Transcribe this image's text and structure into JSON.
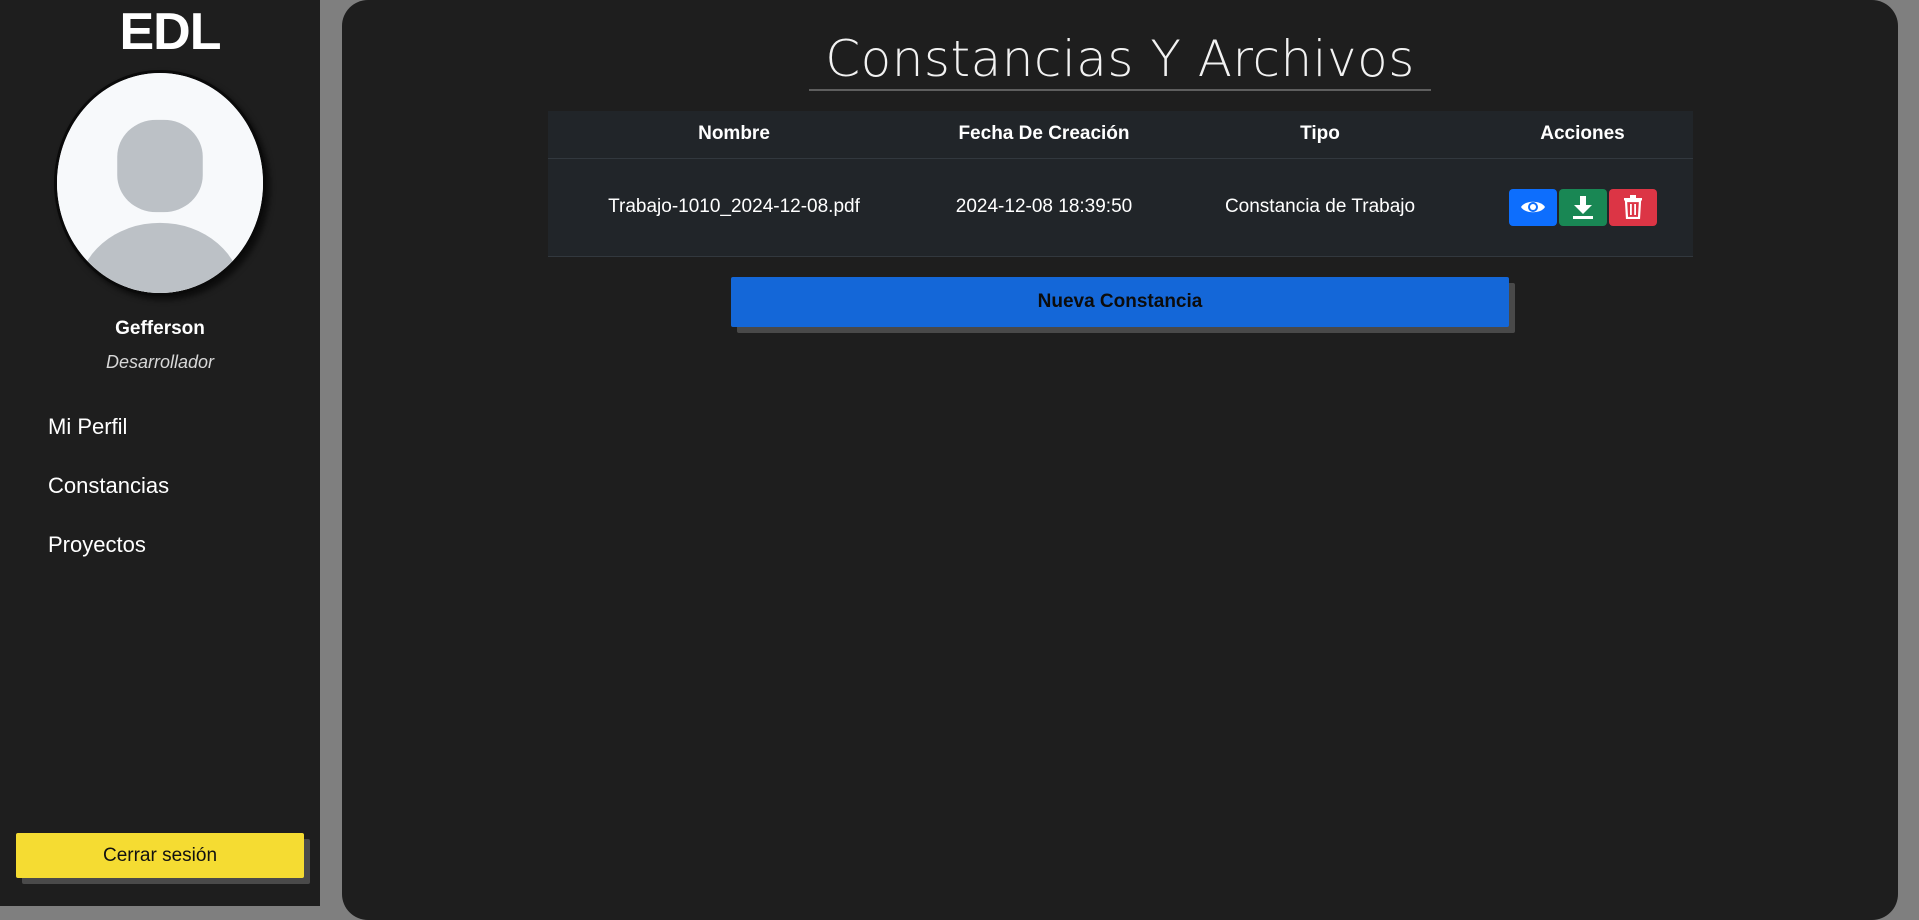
{
  "sidebar": {
    "brand": "EDL",
    "user_name": "Gefferson",
    "user_role": "Desarrollador",
    "nav": [
      {
        "label": "Mi Perfil"
      },
      {
        "label": "Constancias"
      },
      {
        "label": "Proyectos"
      }
    ],
    "logout_label": "Cerrar sesión",
    "logout_color": "#f5dc32"
  },
  "main": {
    "title": "Constancias Y Archivos",
    "table": {
      "columns": [
        "Nombre",
        "Fecha De Creación",
        "Tipo",
        "Acciones"
      ],
      "rows": [
        {
          "nombre": "Trabajo-1010_2024-12-08.pdf",
          "fecha": "2024-12-08 18:39:50",
          "tipo": "Constancia de Trabajo",
          "actions": [
            {
              "icon": "eye-icon",
              "color": "#0d6efd"
            },
            {
              "icon": "download-icon",
              "color": "#198754"
            },
            {
              "icon": "trash-icon",
              "color": "#dc3545"
            }
          ]
        }
      ]
    },
    "new_button_label": "Nueva Constancia",
    "new_button_color": "#1467d8"
  }
}
